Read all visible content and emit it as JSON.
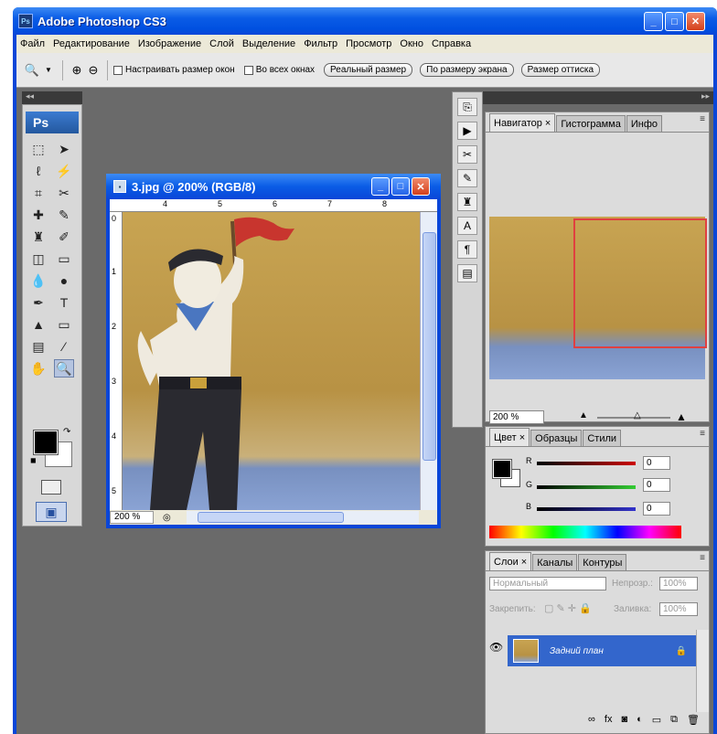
{
  "window": {
    "title": "Adobe Photoshop CS3"
  },
  "menu": [
    "Файл",
    "Редактирование",
    "Изображение",
    "Слой",
    "Выделение",
    "Фильтр",
    "Просмотр",
    "Окно",
    "Справка"
  ],
  "options": {
    "resize_windows": "Настраивать размер окон",
    "all_windows": "Во всех окнах",
    "actual_pixels": "Реальный размер",
    "fit_screen": "По размеру экрана",
    "print_size": "Размер оттиска"
  },
  "toolbox": {
    "logo": "Ps"
  },
  "document": {
    "title": "3.jpg @ 200% (RGB/8)",
    "zoom": "200 %",
    "ruler_h": [
      "4",
      "5",
      "6",
      "7",
      "8"
    ],
    "ruler_v": [
      "0",
      "1",
      "2",
      "3",
      "4",
      "5"
    ]
  },
  "navigator": {
    "tabs": [
      "Навигатор",
      "Гистограмма",
      "Инфо"
    ],
    "zoom": "200 %"
  },
  "color": {
    "tabs": [
      "Цвет",
      "Образцы",
      "Стили"
    ],
    "r_label": "R",
    "g_label": "G",
    "b_label": "B",
    "r": "0",
    "g": "0",
    "b": "0"
  },
  "layers": {
    "tabs": [
      "Слои",
      "Каналы",
      "Контуры"
    ],
    "blend": "Нормальный",
    "opacity_label": "Непрозр.:",
    "opacity": "100%",
    "lock_label": "Закрепить:",
    "fill_label": "Заливка:",
    "fill": "100%",
    "layer_name": "Задний план"
  },
  "colors": {
    "title_blue": "#0a46d8",
    "selected_layer": "#3366cc",
    "close_red": "#d4401c"
  }
}
